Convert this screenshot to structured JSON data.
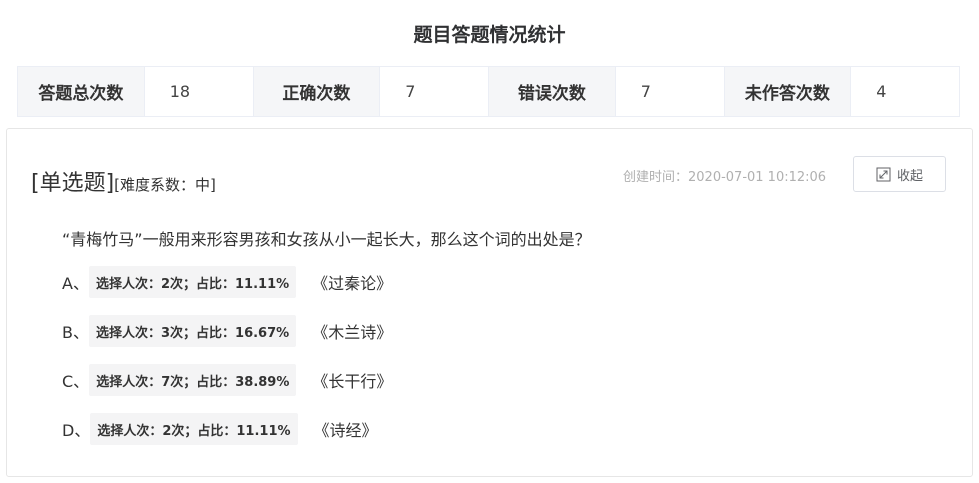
{
  "page_title": "题目答题情况统计",
  "stats": [
    {
      "label": "答题总次数",
      "value": "18"
    },
    {
      "label": "正确次数",
      "value": "7"
    },
    {
      "label": "错误次数",
      "value": "7"
    },
    {
      "label": "未作答次数",
      "value": "4"
    }
  ],
  "question": {
    "type": "[单选题]",
    "difficulty": "[难度系数：中]",
    "created": "创建时间：2020-07-01 10:12:06",
    "collapse_label": "收起",
    "collapse_icon": "collapse-icon",
    "text": "“青梅竹马”一般用来形容男孩和女孩从小一起长大，那么这个词的出处是？",
    "options": [
      {
        "letter": "A、",
        "stat": "选择人次：2次；占比：11.11%",
        "text": "《过秦论》"
      },
      {
        "letter": "B、",
        "stat": "选择人次：3次；占比：16.67%",
        "text": "《木兰诗》"
      },
      {
        "letter": "C、",
        "stat": "选择人次：7次；占比：38.89%",
        "text": "《长干行》"
      },
      {
        "letter": "D、",
        "stat": "选择人次：2次；占比：11.11%",
        "text": "《诗经》"
      }
    ]
  }
}
